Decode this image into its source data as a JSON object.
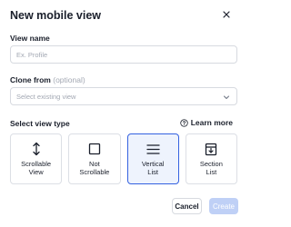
{
  "dialog": {
    "title": "New mobile view",
    "close_icon": "close-icon"
  },
  "view_name": {
    "label": "View name",
    "placeholder": "Ex. Profile",
    "value": ""
  },
  "clone_from": {
    "label": "Clone from",
    "optional_note": "(optional)",
    "placeholder": "Select existing view",
    "chevron_icon": "chevron-down-icon"
  },
  "view_type": {
    "label": "Select view type",
    "learn_more": "Learn more",
    "help_icon": "help-circle-icon",
    "options": [
      {
        "label": "Scrollable\nView",
        "icon": "vertical-arrows-icon",
        "selected": false
      },
      {
        "label": "Not\nScrollable",
        "icon": "square-icon",
        "selected": false
      },
      {
        "label": "Vertical\nList",
        "icon": "list-icon",
        "selected": true
      },
      {
        "label": "Section\nList",
        "icon": "section-list-icon",
        "selected": false
      }
    ]
  },
  "footer": {
    "cancel_label": "Cancel",
    "create_label": "Create"
  },
  "colors": {
    "accent": "#3461e0",
    "selected_bg": "#eef3fd",
    "create_disabled": "#bfd0f6"
  }
}
